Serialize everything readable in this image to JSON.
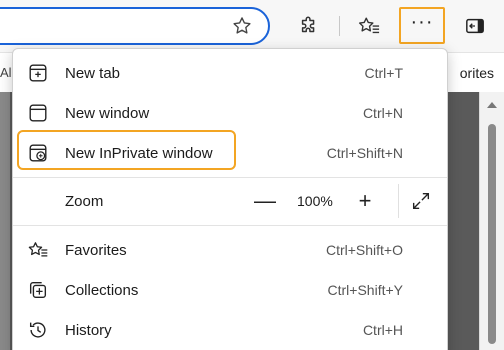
{
  "page": {
    "left_fragment": "Al",
    "right_fragment": "orites"
  },
  "toolbar": {
    "icons": [
      "star-icon",
      "extensions-icon",
      "favorites-icon",
      "more-icon",
      "sidebar-icon"
    ],
    "more_label": "···"
  },
  "menu": {
    "items": [
      {
        "label": "New tab",
        "shortcut": "Ctrl+T",
        "icon": "new-tab-icon"
      },
      {
        "label": "New window",
        "shortcut": "Ctrl+N",
        "icon": "new-window-icon"
      },
      {
        "label": "New InPrivate window",
        "shortcut": "Ctrl+Shift+N",
        "icon": "inprivate-icon"
      },
      {
        "label": "Favorites",
        "shortcut": "Ctrl+Shift+O",
        "icon": "favorites-icon"
      },
      {
        "label": "Collections",
        "shortcut": "Ctrl+Shift+Y",
        "icon": "collections-icon"
      },
      {
        "label": "History",
        "shortcut": "Ctrl+H",
        "icon": "history-icon"
      }
    ],
    "zoom": {
      "label": "Zoom",
      "value": "100%",
      "minus": "—",
      "plus": "+"
    }
  },
  "colors": {
    "highlight": "#f3a523",
    "address_border": "#1a63d9"
  }
}
